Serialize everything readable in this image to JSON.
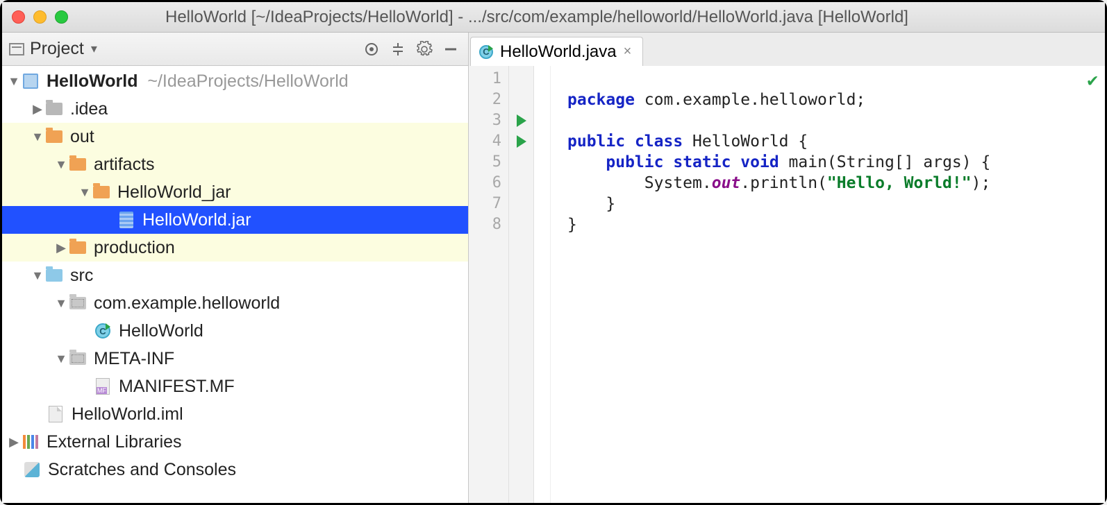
{
  "title": "HelloWorld [~/IdeaProjects/HelloWorld] - .../src/com/example/helloworld/HelloWorld.java [HelloWorld]",
  "panel": {
    "title": "Project"
  },
  "tree": {
    "root": {
      "name": "HelloWorld",
      "hint": "~/IdeaProjects/HelloWorld"
    },
    "idea": {
      "name": ".idea"
    },
    "out": {
      "name": "out"
    },
    "artifacts": {
      "name": "artifacts"
    },
    "hwjar_dir": {
      "name": "HelloWorld_jar"
    },
    "hwjar": {
      "name": "HelloWorld.jar"
    },
    "production": {
      "name": "production"
    },
    "src": {
      "name": "src"
    },
    "pkg": {
      "name": "com.example.helloworld"
    },
    "hwclass": {
      "name": "HelloWorld"
    },
    "metainf": {
      "name": "META-INF"
    },
    "manifest": {
      "name": "MANIFEST.MF"
    },
    "iml": {
      "name": "HelloWorld.iml"
    },
    "extlib": {
      "name": "External Libraries"
    },
    "scratches": {
      "name": "Scratches and Consoles"
    }
  },
  "tab": {
    "label": "HelloWorld.java"
  },
  "gutter": [
    "1",
    "2",
    "3",
    "4",
    "5",
    "6",
    "7",
    "8"
  ],
  "code": {
    "l1_kw": "package",
    "l1_rest": " com.example.helloworld;",
    "l3_kw1": "public",
    "l3_kw2": "class",
    "l3_rest": " HelloWorld {",
    "l4_kw1": "public",
    "l4_kw2": "static",
    "l4_kw3": "void",
    "l4_rest": " main(String[] args) {",
    "l5_pre": "        System.",
    "l5_fld": "out",
    "l5_mid": ".println(",
    "l5_str": "\"Hello, World!\"",
    "l5_post": ");",
    "l6": "    }",
    "l7": "}"
  }
}
